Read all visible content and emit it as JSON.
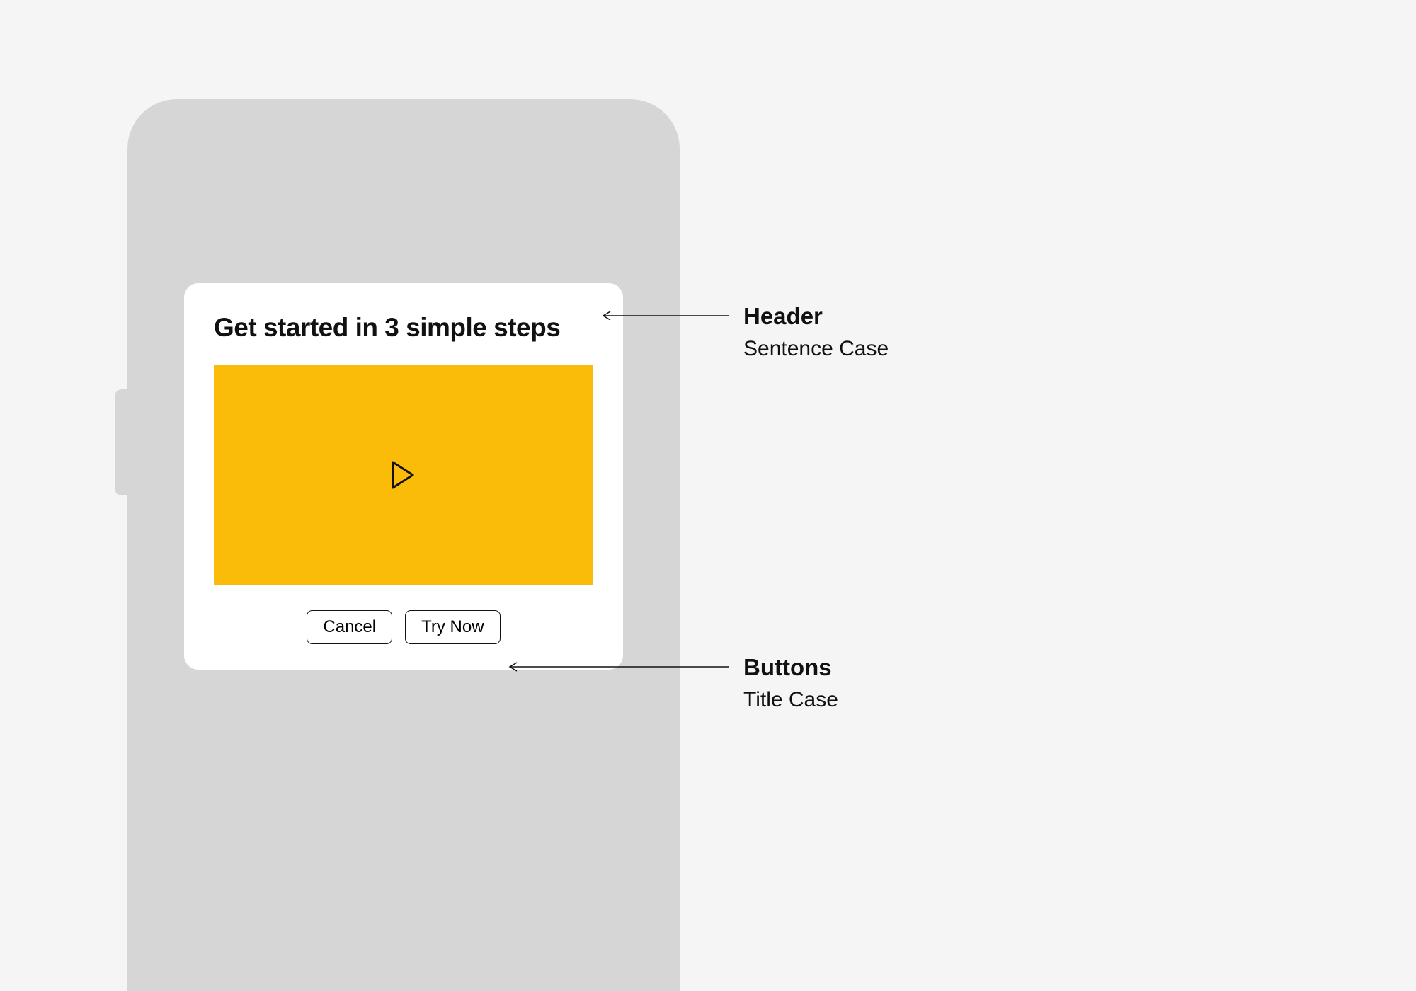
{
  "modal": {
    "header": "Get started in 3 simple steps",
    "buttons": {
      "cancel": "Cancel",
      "primary": "Try Now"
    }
  },
  "annotations": {
    "header": {
      "title": "Header",
      "sub": "Sentence Case"
    },
    "buttons": {
      "title": "Buttons",
      "sub": "Title Case"
    }
  }
}
